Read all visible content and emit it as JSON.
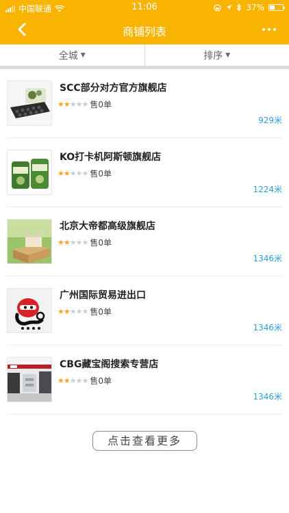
{
  "status": {
    "carrier": "中国联通",
    "time": "11:06",
    "battery": "37%",
    "battery_level": 0.37
  },
  "nav": {
    "title": "商铺列表"
  },
  "filters": [
    {
      "label": "全城"
    },
    {
      "label": "排序"
    }
  ],
  "shops": [
    {
      "name": "SCC部分对方官方旗舰店",
      "stars": 2,
      "sold": "售0单",
      "distance": "929米"
    },
    {
      "name": "KO打卡机阿斯顿旗舰店",
      "stars": 2,
      "sold": "售0单",
      "distance": "1224米"
    },
    {
      "name": "北京大帝都高级旗舰店",
      "stars": 2,
      "sold": "售0单",
      "distance": "1346米"
    },
    {
      "name": "广州国际贸易进出口",
      "stars": 2,
      "sold": "售0单",
      "distance": "1346米"
    },
    {
      "name": "CBG藏宝阁搜索专营店",
      "stars": 2,
      "sold": "售0单",
      "distance": "1346米"
    }
  ],
  "load_more": "点击查看更多",
  "colors": {
    "primary": "#f8b400",
    "distance": "#2a9fd6",
    "star_on": "#f5a623"
  }
}
